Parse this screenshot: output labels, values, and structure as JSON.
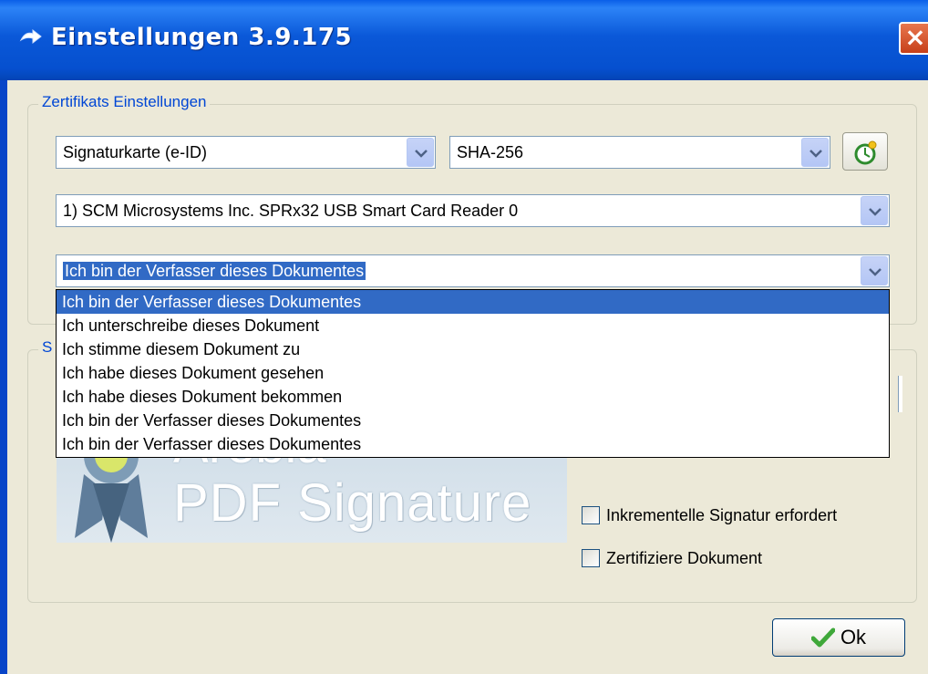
{
  "window": {
    "title": "Einstellungen 3.9.175",
    "close_label": "×"
  },
  "certificate_group": {
    "legend": "Zertifikats Einstellungen",
    "card_type": {
      "value": "Signaturkarte (e-ID)"
    },
    "hash_algorithm": {
      "value": "SHA-256"
    },
    "reader": {
      "value": "1) SCM Microsystems Inc. SPRx32 USB Smart Card Reader 0"
    },
    "reason": {
      "value": "Ich bin der Verfasser dieses Dokumentes"
    }
  },
  "reason_dropdown": {
    "options": [
      "Ich bin der Verfasser dieses Dokumentes",
      "Ich unterschreibe dieses Dokument",
      "Ich stimme diesem Dokument zu",
      "Ich habe dieses Dokument gesehen",
      "Ich habe dieses Dokument bekommen",
      "Ich bin der Verfasser dieses Dokumentes",
      "Ich bin der Verfasser dieses Dokumentes"
    ],
    "selected_index": 0
  },
  "signature_group": {
    "legend_partial": "S",
    "logo": {
      "line1": "Arebia",
      "line2": "PDF Signature"
    },
    "incremental_checkbox": {
      "label": "Inkrementelle Signatur erfordert",
      "checked": false
    },
    "certify_checkbox": {
      "label": "Zertifiziere Dokument",
      "checked": false
    }
  },
  "ok_button": {
    "label": "Ok"
  },
  "colors": {
    "titlebar": "#0a58d8",
    "window_bg": "#ece9d8",
    "selection": "#316ac5",
    "group_legend": "#0046d5"
  }
}
